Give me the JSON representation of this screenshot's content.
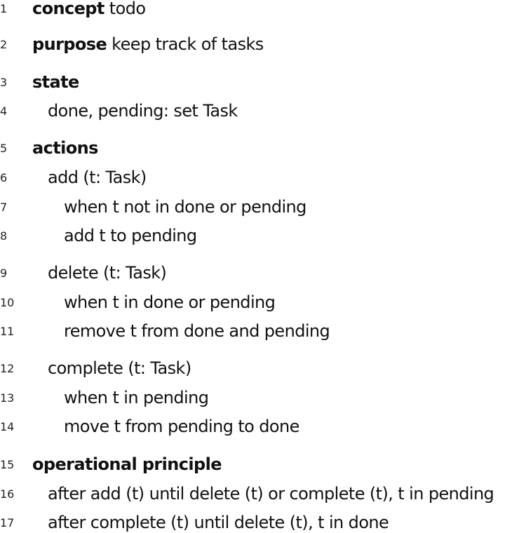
{
  "lines": [
    {
      "num": "1",
      "keyword": "concept",
      "text": " todo"
    },
    {
      "num": "2",
      "keyword": "purpose",
      "text": " keep track of tasks"
    },
    {
      "num": "3",
      "keyword": "state",
      "text": ""
    },
    {
      "num": "4",
      "keyword": "",
      "text": "done, pending: set Task"
    },
    {
      "num": "5",
      "keyword": "actions",
      "text": ""
    },
    {
      "num": "6",
      "keyword": "",
      "text": "add (t: Task)"
    },
    {
      "num": "7",
      "keyword": "",
      "text": "when t not in done or pending"
    },
    {
      "num": "8",
      "keyword": "",
      "text": "add t to pending"
    },
    {
      "num": "9",
      "keyword": "",
      "text": "delete (t: Task)"
    },
    {
      "num": "10",
      "keyword": "",
      "text": "when t in done or pending"
    },
    {
      "num": "11",
      "keyword": "",
      "text": "remove t from done and pending"
    },
    {
      "num": "12",
      "keyword": "",
      "text": "complete (t: Task)"
    },
    {
      "num": "13",
      "keyword": "",
      "text": "when t in pending"
    },
    {
      "num": "14",
      "keyword": "",
      "text": "move t from pending to done"
    },
    {
      "num": "15",
      "keyword": "operational principle",
      "text": ""
    },
    {
      "num": "16",
      "keyword": "",
      "text": "after add (t) until delete (t) or complete (t), t in pending"
    },
    {
      "num": "17",
      "keyword": "",
      "text": "after complete (t) until delete (t), t in done"
    }
  ]
}
